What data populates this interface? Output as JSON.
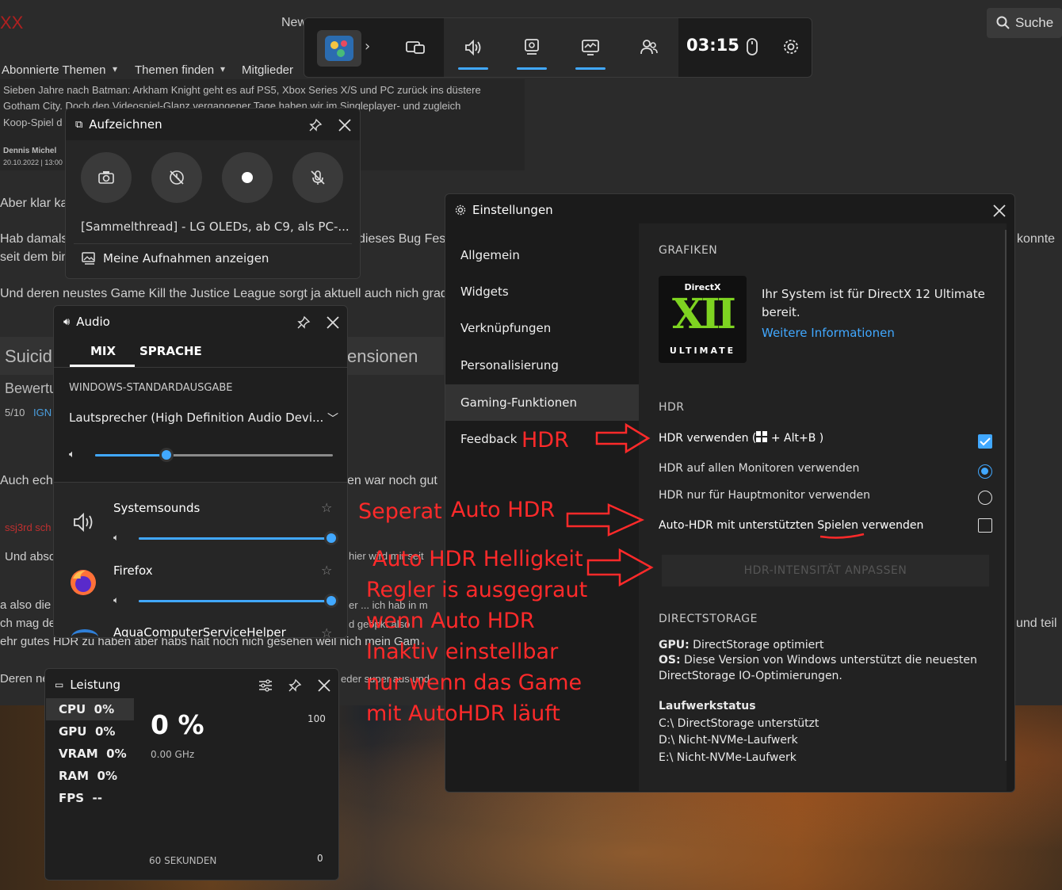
{
  "background": {
    "site_logo": "XX",
    "nav_item": "New",
    "search_label": "Suche",
    "menu": [
      "Abonnierte Themen",
      "Themen finden",
      "Mitglieder"
    ],
    "article_line1": "Sieben Jahre nach Batman: Arkham Knight geht es auf PS5, Xbox Series X/S und PC zurück ins düstere",
    "article_line2": "Gotham City. Doch den Videospiel-Glanz vergangener Tage haben wir im Singleplayer- und zugleich",
    "article_line3": "Koop-Spiel d",
    "author": "Dennis Michel",
    "date": "20.10.2022 | 13:00",
    "post1": "Aber klar kan",
    "post2a": "Hab damals",
    "post2b": "seit dem bin",
    "post2c": "dieses Bug Fest",
    "post2d": "konnte",
    "post3": "Und deren neustes Game Kill the Justice League sorgt ja aktuell auch nich grad",
    "heading_left": "Suicid",
    "heading_right": "ensionen",
    "bewertung": "Bewertu",
    "score": "5/10",
    "score_source": "IGN",
    "post4a": "Auch echt",
    "post4b": "en war noch gut",
    "username": "ssj3rd sch",
    "post5a": "Und abso",
    "post5b": "hier wird mir seit",
    "post6a": "a also die",
    "post6b": "er ... ich hab in m",
    "post7a": "ch mag de",
    "post7b": "d geöpkt also",
    "post7c": "und teil",
    "post8": "ehr gutes HDR zu haben aber habs halt noch nich gesehen weil nich mein Gam",
    "post9a": "Deren ne",
    "post9b": "eder super aus und"
  },
  "gamebar": {
    "time": "03:15",
    "colors": {
      "accent": "#41a8ff"
    },
    "icons": [
      "app-icon",
      "chevron-right-icon",
      "capture-widget-icon",
      "audio-icon",
      "performance-icon",
      "resources-icon",
      "social-icon",
      "mouse-icon",
      "settings-icon"
    ]
  },
  "capture": {
    "title": "Aufzeichnen",
    "game_name": "[Sammelthread] - LG OLEDs, ab C9, als PC-...",
    "show_recordings": "Meine Aufnahmen anzeigen"
  },
  "audio": {
    "title": "Audio",
    "tabs": [
      "MIX",
      "SPRACHE"
    ],
    "section": "WINDOWS-STANDARDAUSGABE",
    "device": "Lautsprecher (High Definition Audio Devi...",
    "master_level": 0.3,
    "apps": [
      {
        "name": "Systemsounds",
        "level": 1.0
      },
      {
        "name": "Firefox",
        "level": 1.0
      },
      {
        "name": "AquaComputerServiceHelper"
      }
    ]
  },
  "performance": {
    "title": "Leistung",
    "metrics": [
      {
        "label": "CPU",
        "value": "0%"
      },
      {
        "label": "GPU",
        "value": "0%"
      },
      {
        "label": "VRAM",
        "value": "0%"
      },
      {
        "label": "RAM",
        "value": "0%"
      },
      {
        "label": "FPS",
        "value": "--"
      }
    ],
    "big_value": "0 %",
    "freq": "0.00 GHz",
    "max": "100",
    "min": "0",
    "window": "60 SEKUNDEN"
  },
  "settings": {
    "title": "Einstellungen",
    "nav": [
      "Allgemein",
      "Widgets",
      "Verknüpfungen",
      "Personalisierung",
      "Gaming-Funktionen",
      "Feedback"
    ],
    "active_nav": "Gaming-Funktionen",
    "graphics_header": "GRAFIKEN",
    "dx_logo_top": "DirectX",
    "dx_logo_main": "XII",
    "dx_logo_bottom": "ULTIMATE",
    "dx_text": "Ihr System ist für DirectX 12 Ultimate bereit.",
    "dx_link": "Weitere Informationen",
    "hdr_header": "HDR",
    "hdr_use_pre": "HDR verwenden (",
    "hdr_use_post": " + Alt+B )",
    "hdr_all": "HDR auf allen Monitoren verwenden",
    "hdr_main": "HDR nur für Hauptmonitor verwenden",
    "auto_hdr": "Auto-HDR mit unterstützten Spielen verwenden",
    "intensity_button": "HDR-INTENSITÄT ANPASSEN",
    "ds_header": "DIRECTSTORAGE",
    "gpu_label": "GPU:",
    "gpu_text": "DirectStorage optimiert",
    "os_label": "OS:",
    "os_text": "Diese Version von Windows unterstützt die neuesten",
    "os_text2": "DirectStorage IO-Optimierungen.",
    "drive_header": "Laufwerkstatus",
    "drives": [
      "C:\\ DirectStorage unterstützt",
      "D:\\ Nicht-NVMe-Laufwerk",
      "E:\\ Nicht-NVMe-Laufwerk"
    ]
  },
  "annotations": {
    "hdr": "HDR",
    "seperat": "Seperat",
    "auto_hdr": "Auto HDR",
    "lines": [
      "Auto HDR Helligkeit",
      "Regler is ausgegraut",
      "wenn Auto HDR",
      "Inaktiv einstellbar",
      "nur wenn das Game",
      "mit AutoHDR läuft"
    ]
  }
}
